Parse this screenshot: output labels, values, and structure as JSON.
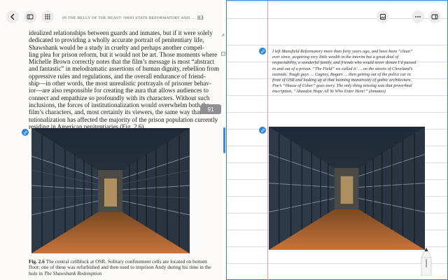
{
  "book": {
    "running_head": "IN THE BELLY OF THE BEAST: OHIO STATE REFORMATORY AND THE...",
    "page_number": "83",
    "paragraph_lines": [
      "idealized relationships between guards and inmates, but if it were solely",
      "dedicated to providing a wholly accurate portrait of penitentiary life,",
      "Shawshank would be a study in cruelty and perhaps another compel-",
      "ling plea for prison reform, but it would not be art. Those moments where",
      "Michelle Brown correctly notes that the film’s message is most “abstract",
      "and fantastic” in melodramatic assertions of human dignity, rebellion from",
      "oppressive rules and regulations, and the overall endurance of friend-",
      "ship—in other words, the most unrealistic portrayals of prisoner behav-",
      "ior—are also responsible for creating the aura that allows audiences to",
      "connect and empathize so profoundly with its characters. Without such",
      "inclusions, the forces of institutionalization would overwhelm both the",
      "film’s characters, and, most certainly its viewers, the same way that insti-",
      "tutionalization has affected the majority of the prison population currently",
      "residing in American penitentiaries (Fig. 2.6)."
    ],
    "caption_label": "Fig. 2.6",
    "caption_text": "The central cellblock at OSR. Solitary confinement cells are located on bottom floor; one of these was refurbished and then used to imprison Andy during his time in the hole in",
    "caption_title": "The Shawshank Redemption",
    "page_badge": "91"
  },
  "notes": {
    "quote": "I left Mansfield Reformatory more than forty years ago, and have been “clean” ever since, acquiring very little wealth in the interim but a great deal of respectability, a wonderful family, and friends who would never dream I’d passed in and out of a prison. “The Field” we called it’ … on the streets of Cleveland’s eastside. Tough guys … Cagney, Bogart … then getting out of the police car in front of OSR and looking up at that looming monstrosity of gothic architecture, Poe’s “House of Usher” goes awry. The only thing missing was that proverbial inscription, “Abandon Hope All Ye Who Enter Here!” (Inmates)"
  },
  "icons": {
    "back": "chevron-left-icon",
    "sidebar": "sidebar-icon",
    "grid": "grid-icon",
    "image": "image-icon",
    "more": "ellipsis-icon",
    "panel": "panel-icon",
    "marker": "link-icon",
    "pencil": "pencil-icon"
  },
  "colors": {
    "accent": "#2f7fdc",
    "margin_line": "#e99aa0",
    "badge": "#8e8e93"
  }
}
